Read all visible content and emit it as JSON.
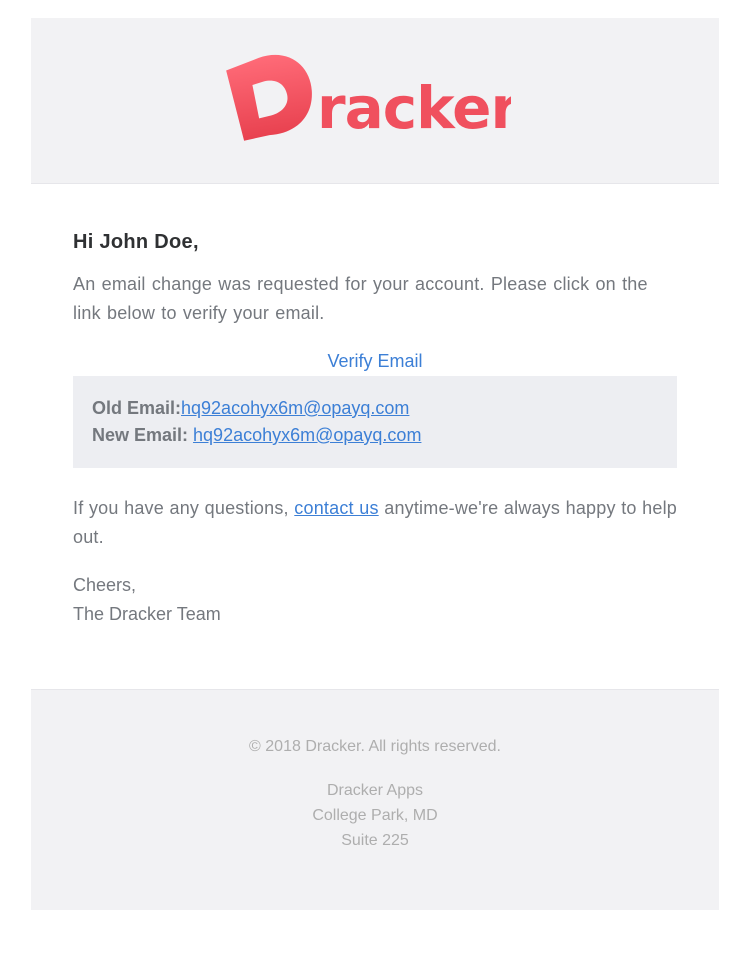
{
  "brand": {
    "logo_text": "Dracker",
    "logo_color": "#f0505e"
  },
  "message": {
    "greeting": "Hi John Doe,",
    "body": "An email change was requested for your account. Please click on the link below to verify your email.",
    "verify_label": "Verify Email",
    "old_email_label": "Old Email:",
    "old_email": "hq92acohyx6m@opayq.com",
    "new_email_label": "New Email: ",
    "new_email": "hq92acohyx6m@opayq.com",
    "questions_before": "If you have any questions, ",
    "contact_label": "contact us",
    "questions_after": " anytime-we're always happy to help out.",
    "cheers": "Cheers,",
    "team": "The Dracker Team"
  },
  "footer": {
    "copyright": "© 2018 Dracker. All rights reserved.",
    "address": [
      "Dracker Apps",
      "College Park, MD",
      "Suite 225"
    ]
  },
  "colors": {
    "accent_link": "#3c7fd6",
    "text": "#74787e",
    "heading": "#2f3133",
    "panel_bg": "#f2f2f4"
  }
}
